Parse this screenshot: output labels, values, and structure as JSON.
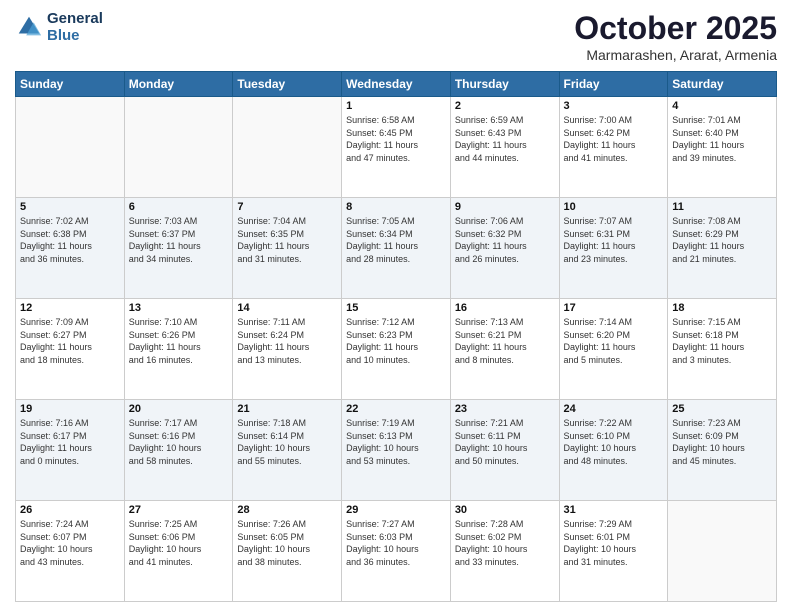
{
  "header": {
    "logo_line1": "General",
    "logo_line2": "Blue",
    "month": "October 2025",
    "location": "Marmarashen, Ararat, Armenia"
  },
  "days_of_week": [
    "Sunday",
    "Monday",
    "Tuesday",
    "Wednesday",
    "Thursday",
    "Friday",
    "Saturday"
  ],
  "weeks": [
    [
      {
        "day": "",
        "info": ""
      },
      {
        "day": "",
        "info": ""
      },
      {
        "day": "",
        "info": ""
      },
      {
        "day": "1",
        "info": "Sunrise: 6:58 AM\nSunset: 6:45 PM\nDaylight: 11 hours\nand 47 minutes."
      },
      {
        "day": "2",
        "info": "Sunrise: 6:59 AM\nSunset: 6:43 PM\nDaylight: 11 hours\nand 44 minutes."
      },
      {
        "day": "3",
        "info": "Sunrise: 7:00 AM\nSunset: 6:42 PM\nDaylight: 11 hours\nand 41 minutes."
      },
      {
        "day": "4",
        "info": "Sunrise: 7:01 AM\nSunset: 6:40 PM\nDaylight: 11 hours\nand 39 minutes."
      }
    ],
    [
      {
        "day": "5",
        "info": "Sunrise: 7:02 AM\nSunset: 6:38 PM\nDaylight: 11 hours\nand 36 minutes."
      },
      {
        "day": "6",
        "info": "Sunrise: 7:03 AM\nSunset: 6:37 PM\nDaylight: 11 hours\nand 34 minutes."
      },
      {
        "day": "7",
        "info": "Sunrise: 7:04 AM\nSunset: 6:35 PM\nDaylight: 11 hours\nand 31 minutes."
      },
      {
        "day": "8",
        "info": "Sunrise: 7:05 AM\nSunset: 6:34 PM\nDaylight: 11 hours\nand 28 minutes."
      },
      {
        "day": "9",
        "info": "Sunrise: 7:06 AM\nSunset: 6:32 PM\nDaylight: 11 hours\nand 26 minutes."
      },
      {
        "day": "10",
        "info": "Sunrise: 7:07 AM\nSunset: 6:31 PM\nDaylight: 11 hours\nand 23 minutes."
      },
      {
        "day": "11",
        "info": "Sunrise: 7:08 AM\nSunset: 6:29 PM\nDaylight: 11 hours\nand 21 minutes."
      }
    ],
    [
      {
        "day": "12",
        "info": "Sunrise: 7:09 AM\nSunset: 6:27 PM\nDaylight: 11 hours\nand 18 minutes."
      },
      {
        "day": "13",
        "info": "Sunrise: 7:10 AM\nSunset: 6:26 PM\nDaylight: 11 hours\nand 16 minutes."
      },
      {
        "day": "14",
        "info": "Sunrise: 7:11 AM\nSunset: 6:24 PM\nDaylight: 11 hours\nand 13 minutes."
      },
      {
        "day": "15",
        "info": "Sunrise: 7:12 AM\nSunset: 6:23 PM\nDaylight: 11 hours\nand 10 minutes."
      },
      {
        "day": "16",
        "info": "Sunrise: 7:13 AM\nSunset: 6:21 PM\nDaylight: 11 hours\nand 8 minutes."
      },
      {
        "day": "17",
        "info": "Sunrise: 7:14 AM\nSunset: 6:20 PM\nDaylight: 11 hours\nand 5 minutes."
      },
      {
        "day": "18",
        "info": "Sunrise: 7:15 AM\nSunset: 6:18 PM\nDaylight: 11 hours\nand 3 minutes."
      }
    ],
    [
      {
        "day": "19",
        "info": "Sunrise: 7:16 AM\nSunset: 6:17 PM\nDaylight: 11 hours\nand 0 minutes."
      },
      {
        "day": "20",
        "info": "Sunrise: 7:17 AM\nSunset: 6:16 PM\nDaylight: 10 hours\nand 58 minutes."
      },
      {
        "day": "21",
        "info": "Sunrise: 7:18 AM\nSunset: 6:14 PM\nDaylight: 10 hours\nand 55 minutes."
      },
      {
        "day": "22",
        "info": "Sunrise: 7:19 AM\nSunset: 6:13 PM\nDaylight: 10 hours\nand 53 minutes."
      },
      {
        "day": "23",
        "info": "Sunrise: 7:21 AM\nSunset: 6:11 PM\nDaylight: 10 hours\nand 50 minutes."
      },
      {
        "day": "24",
        "info": "Sunrise: 7:22 AM\nSunset: 6:10 PM\nDaylight: 10 hours\nand 48 minutes."
      },
      {
        "day": "25",
        "info": "Sunrise: 7:23 AM\nSunset: 6:09 PM\nDaylight: 10 hours\nand 45 minutes."
      }
    ],
    [
      {
        "day": "26",
        "info": "Sunrise: 7:24 AM\nSunset: 6:07 PM\nDaylight: 10 hours\nand 43 minutes."
      },
      {
        "day": "27",
        "info": "Sunrise: 7:25 AM\nSunset: 6:06 PM\nDaylight: 10 hours\nand 41 minutes."
      },
      {
        "day": "28",
        "info": "Sunrise: 7:26 AM\nSunset: 6:05 PM\nDaylight: 10 hours\nand 38 minutes."
      },
      {
        "day": "29",
        "info": "Sunrise: 7:27 AM\nSunset: 6:03 PM\nDaylight: 10 hours\nand 36 minutes."
      },
      {
        "day": "30",
        "info": "Sunrise: 7:28 AM\nSunset: 6:02 PM\nDaylight: 10 hours\nand 33 minutes."
      },
      {
        "day": "31",
        "info": "Sunrise: 7:29 AM\nSunset: 6:01 PM\nDaylight: 10 hours\nand 31 minutes."
      },
      {
        "day": "",
        "info": ""
      }
    ]
  ]
}
